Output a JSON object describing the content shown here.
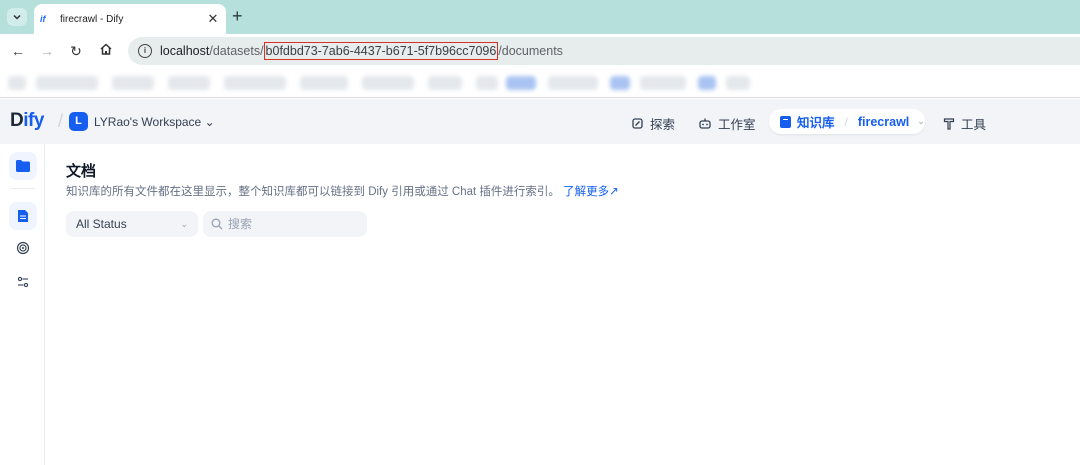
{
  "browser": {
    "tab_title": "firecrawl - Dify",
    "tab_favicon": "if",
    "url_host": "localhost",
    "url_path_before": "/datasets/",
    "url_highlight": "b0fdbd73-7ab6-4437-b671-5f7b96cc7096",
    "url_path_after": "/documents",
    "highlight_color": "#d93025"
  },
  "header": {
    "logo_d": "D",
    "logo_ify": "ify",
    "workspace_initial": "L",
    "workspace_name": "LYRao's Workspace",
    "nav": {
      "explore": "探索",
      "studio": "工作室",
      "knowledge": "知识库",
      "dataset_name": "firecrawl",
      "tools": "工具"
    },
    "accent_color": "#155eef"
  },
  "main": {
    "title": "文档",
    "description": "知识库的所有文件都在这里显示，整个知识库都可以链接到 Dify 引用或通过 Chat 插件进行索引。",
    "learn_more": "了解更多",
    "status_filter": "All Status",
    "search_placeholder": "搜索"
  },
  "rail": {
    "icons": [
      "folder-icon",
      "document-icon",
      "target-icon",
      "settings-sliders-icon"
    ]
  }
}
